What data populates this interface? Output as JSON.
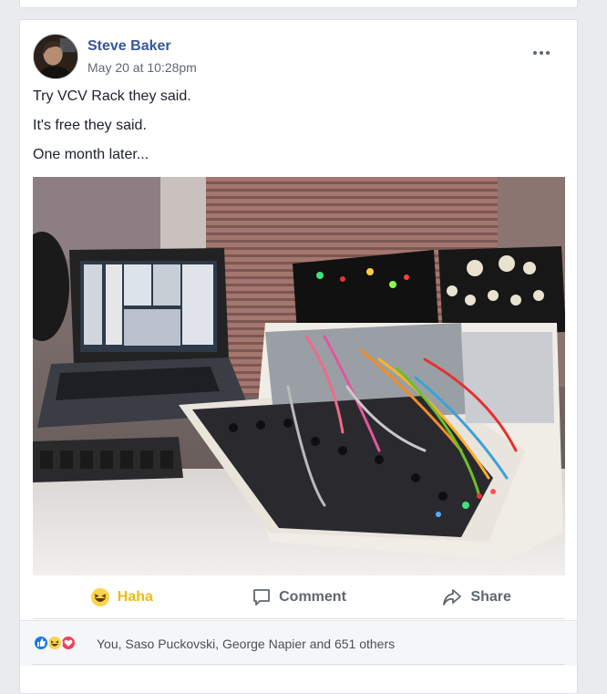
{
  "post": {
    "author": "Steve Baker",
    "timestamp": "May 20 at 10:28pm",
    "lines": [
      "Try VCV Rack they said.",
      "It's free they said.",
      "One month later..."
    ]
  },
  "actions": {
    "haha_label": "Haha",
    "comment_label": "Comment",
    "share_label": "Share"
  },
  "reactions": {
    "icons": [
      "like-icon",
      "haha-icon",
      "love-icon"
    ],
    "summary": "You, Saso Puckovski, George Napier and 651 others"
  },
  "colors": {
    "link": "#365899",
    "haha": "#f0ba15",
    "like": "#1877f2",
    "love": "#f33e58",
    "muted": "#606770"
  }
}
